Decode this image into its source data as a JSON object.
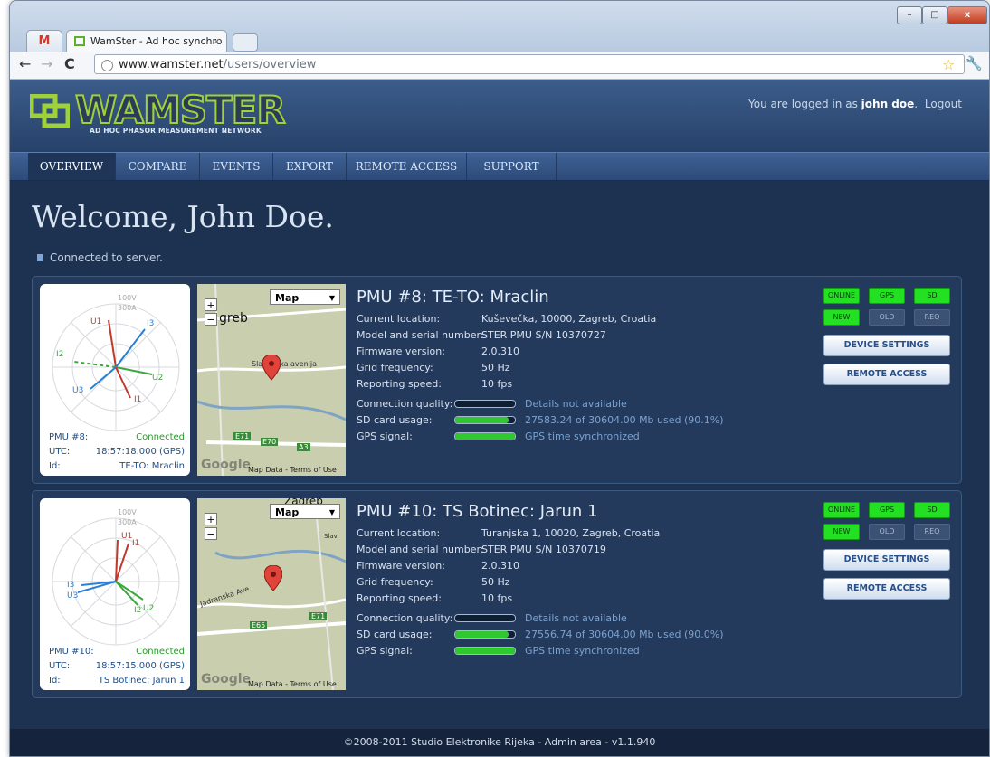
{
  "browser": {
    "tab_gmail_icon": "M",
    "tab_title": "WamSter - Ad hoc synchro",
    "url_host": "www.wamster.net",
    "url_path": "/users/overview",
    "win_min": "–",
    "win_max": "□",
    "win_close": "x"
  },
  "header": {
    "logo_text": "WAMSTER",
    "logo_sub": "AD HOC PHASOR MEASUREMENT NETWORK",
    "login_prefix": "You are logged in as",
    "user": "john doe",
    "logout": "Logout"
  },
  "nav": {
    "items": [
      {
        "label": "OVERVIEW"
      },
      {
        "label": "COMPARE"
      },
      {
        "label": "EVENTS"
      },
      {
        "label": "EXPORT"
      },
      {
        "label": "REMOTE ACCESS"
      },
      {
        "label": "SUPPORT"
      }
    ]
  },
  "page": {
    "welcome": "Welcome, John Doe.",
    "status": "Connected to server."
  },
  "labels": {
    "location": "Current location:",
    "model": "Model and serial number:",
    "firmware": "Firmware version:",
    "grid": "Grid frequency:",
    "reporting": "Reporting speed:",
    "conn_quality": "Connection quality:",
    "sd_usage": "SD card usage:",
    "gps_signal": "GPS signal:",
    "pmu_label": "PMU",
    "utc_label": "UTC:",
    "id_label": "Id:",
    "device_settings": "DEVICE SETTINGS",
    "remote_access": "REMOTE ACCESS",
    "ind_online": "ONLINE",
    "ind_gps": "GPS",
    "ind_sd": "SD",
    "ind_new": "NEW",
    "ind_old": "OLD",
    "ind_req": "REQ",
    "map_select": "Map",
    "map_footer": "Map Data - Terms of Use",
    "map_google": "Google",
    "zoom_in": "+",
    "zoom_out": "−",
    "scale_v": "100V",
    "scale_a": "300A"
  },
  "pmus": [
    {
      "title": "PMU #8: TE-TO: Mraclin",
      "pmu_num": "PMU #8:",
      "status": "Connected",
      "utc": "18:57:18.000 (GPS)",
      "id": "TE-TO: Mraclin",
      "location": "Kuševečka, 10000, Zagreb, Croatia",
      "model": "STER PMU S/N 10370727",
      "firmware": "2.0.310",
      "grid": "50 Hz",
      "reporting": "10 fps",
      "conn_note": "Details not available",
      "conn_level": 0,
      "sd_note": "27583.24 of 30604.00 Mb used (90.1%)",
      "sd_level": 90.1,
      "gps_note": "GPS time synchronized",
      "gps_level": 100,
      "map_label_city": "greb",
      "map_label_road": "Slavonska avenija",
      "map_road_1": "E71",
      "map_road_2": "E70",
      "map_road_3": "A3"
    },
    {
      "title": "PMU #10: TS Botinec: Jarun 1",
      "pmu_num": "PMU #10:",
      "status": "Connected",
      "utc": "18:57:15.000 (GPS)",
      "id": "TS Botinec: Jarun 1",
      "location": "Turanjska 1, 10020, Zagreb, Croatia",
      "model": "STER PMU S/N 10370719",
      "firmware": "2.0.310",
      "grid": "50 Hz",
      "reporting": "10 fps",
      "conn_note": "Details not available",
      "conn_level": 0,
      "sd_note": "27556.74 of 30604.00 Mb used (90.0%)",
      "sd_level": 90.0,
      "gps_note": "GPS time synchronized",
      "gps_level": 100,
      "map_label_city": "Zagreb",
      "map_label_road": "Jadranska Ave",
      "map_road_1": "E65",
      "map_road_2": "E71",
      "map_road_3": "Slav"
    }
  ],
  "footer": {
    "text": "©2008-2011 Studio Elektronike Rijeka - Admin area - v1.1.940"
  },
  "colors": {
    "page_bg": "#1d3150",
    "indicator_on": "#23e023",
    "indicator_off": "#3b5275",
    "u_series": "#c0392b",
    "i_series": "#2a7fd4",
    "green_series": "#3aa83a"
  }
}
